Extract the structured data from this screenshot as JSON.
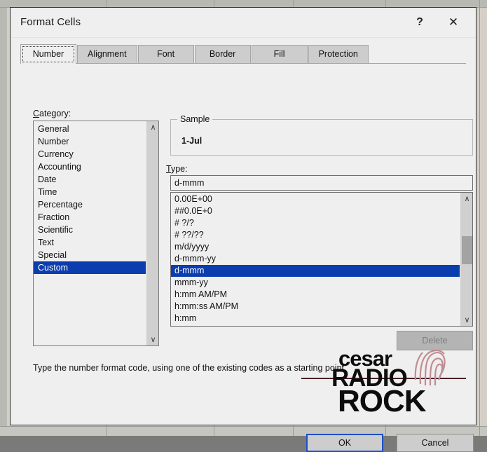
{
  "window": {
    "title": "Format Cells",
    "help_icon": "?",
    "close_icon": "✕"
  },
  "tabs": [
    {
      "label": "Number",
      "selected": true
    },
    {
      "label": "Alignment",
      "selected": false
    },
    {
      "label": "Font",
      "selected": false
    },
    {
      "label": "Border",
      "selected": false
    },
    {
      "label": "Fill",
      "selected": false
    },
    {
      "label": "Protection",
      "selected": false
    }
  ],
  "category": {
    "label_prefix": "C",
    "label_rest": "ategory:",
    "items": [
      {
        "label": "General",
        "selected": false
      },
      {
        "label": "Number",
        "selected": false
      },
      {
        "label": "Currency",
        "selected": false
      },
      {
        "label": "Accounting",
        "selected": false
      },
      {
        "label": "Date",
        "selected": false
      },
      {
        "label": "Time",
        "selected": false
      },
      {
        "label": "Percentage",
        "selected": false
      },
      {
        "label": "Fraction",
        "selected": false
      },
      {
        "label": "Scientific",
        "selected": false
      },
      {
        "label": "Text",
        "selected": false
      },
      {
        "label": "Special",
        "selected": false
      },
      {
        "label": "Custom",
        "selected": true
      }
    ],
    "scroll_up_icon": "∧",
    "scroll_down_icon": "∨"
  },
  "sample": {
    "legend": "Sample",
    "value": "1-Jul"
  },
  "type": {
    "label_prefix": "T",
    "label_rest": "ype:",
    "value": "d-mmm",
    "placeholder": "",
    "items": [
      {
        "label": "0.00E+00",
        "selected": false
      },
      {
        "label": "##0.0E+0",
        "selected": false
      },
      {
        "label": "# ?/?",
        "selected": false
      },
      {
        "label": "# ??/??",
        "selected": false
      },
      {
        "label": "m/d/yyyy",
        "selected": false
      },
      {
        "label": "d-mmm-yy",
        "selected": false
      },
      {
        "label": "d-mmm",
        "selected": true
      },
      {
        "label": "mmm-yy",
        "selected": false
      },
      {
        "label": "h:mm AM/PM",
        "selected": false
      },
      {
        "label": "h:mm:ss AM/PM",
        "selected": false
      },
      {
        "label": "h:mm",
        "selected": false
      }
    ],
    "scroll_up_icon": "∧",
    "scroll_down_icon": "∨"
  },
  "buttons": {
    "delete": "Delete",
    "ok": "OK",
    "cancel": "Cancel"
  },
  "hint": "Type the number format code, using one of the existing codes as a starting point.",
  "watermark": {
    "line1": "cesar",
    "line2": "RADIO",
    "line3": "ROCK"
  },
  "colors": {
    "selection_blue": "#0b3dae",
    "dialog_background": "#efefef",
    "tab_inactive": "#cdcdcd",
    "button_face": "#cdcdcd",
    "ok_focus_border": "#1e4fc4",
    "disabled_text": "#7d7d7d",
    "watermark_ink": "#0d0d0d",
    "watermark_accent": "#c08d92",
    "sheet_background": "#d4d0c8"
  }
}
